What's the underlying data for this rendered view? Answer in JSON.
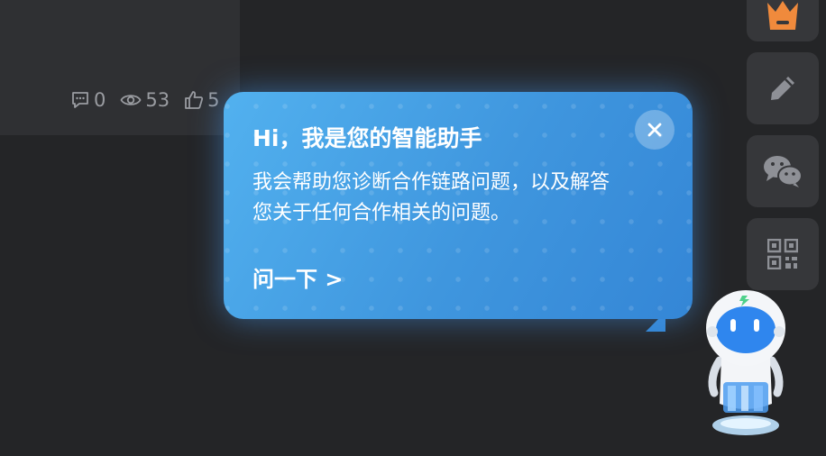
{
  "article_card": {
    "comments_count": "0",
    "views_count": "53",
    "likes_count": "5"
  },
  "sidebar": {
    "buttons": [
      {
        "icon": "crown-icon"
      },
      {
        "icon": "pencil-icon"
      },
      {
        "icon": "wechat-icon"
      },
      {
        "icon": "qrcode-icon"
      }
    ]
  },
  "assistant_popup": {
    "title": "Hi，我是您的智能助手",
    "body": "我会帮助您诊断合作链路问题，以及解答您关于任何合作相关的问题。",
    "ask_link": "问一下 >",
    "close_icon": "close-icon"
  },
  "assistant_avatar": {
    "icon": "robot-icon"
  },
  "colors": {
    "background": "#242527",
    "card": "#2f3033",
    "popup_blue": "#3e93dc",
    "crown_orange": "#f08a3c"
  }
}
